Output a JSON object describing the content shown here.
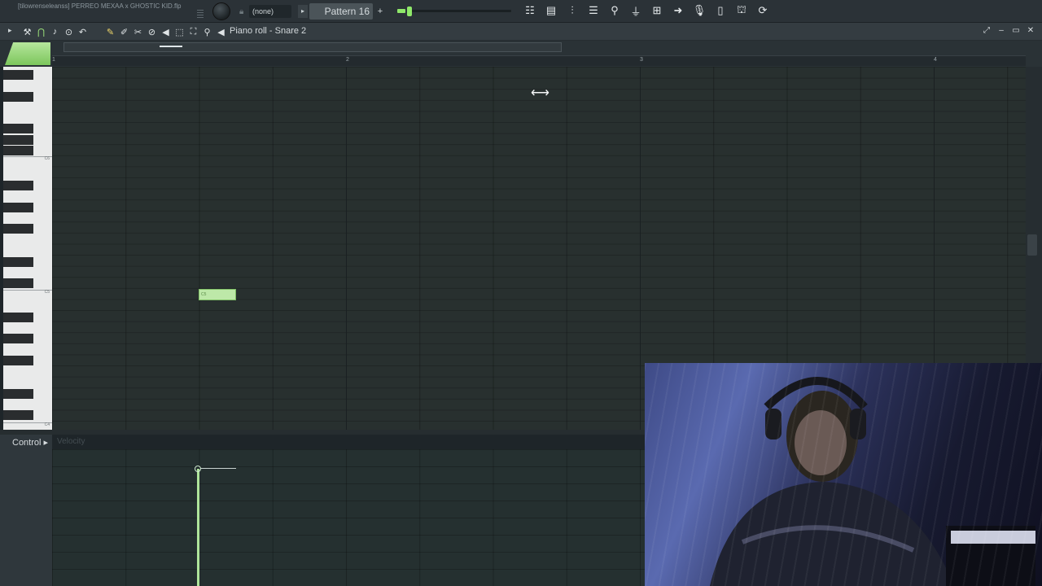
{
  "toolbar": {
    "project_title": "[tilowrenseleanss] PERREO MEXAA x GHOSTIC KID.flp",
    "preset": "(none)",
    "pattern_arrow": "▸",
    "pattern": "Pattern 16",
    "pattern_add": "+",
    "icons": [
      "playlist-icon",
      "channel-rack-icon",
      "mixer-icon",
      "piano-roll-icon",
      "browser-icon",
      "plugin-picker-icon",
      "tempo-tapper-icon",
      "export-icon",
      "recording-icon",
      "file-icon",
      "stamp-icon",
      "undo-history-icon"
    ]
  },
  "piano_roll": {
    "title": "Piano roll - Snare 2",
    "window_buttons": [
      "⤢",
      "–",
      "▭",
      "✕"
    ]
  },
  "ruler": {
    "bars": [
      "1",
      "2",
      "3",
      "4"
    ]
  },
  "keys": {
    "labels": [
      "C6",
      "C5",
      "C4"
    ]
  },
  "note": {
    "label": "C5"
  },
  "control": {
    "label": "Control ▸",
    "target": "Velocity",
    "velocity_level": 0.86
  },
  "webcam": {
    "description": "presenter-webcam"
  }
}
